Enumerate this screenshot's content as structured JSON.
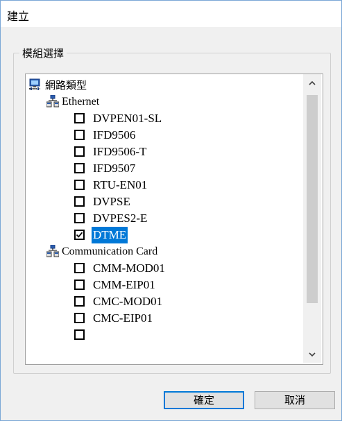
{
  "window": {
    "title": "建立"
  },
  "group": {
    "legend": "模組選擇"
  },
  "tree": {
    "root": {
      "label": "網路類型",
      "icon": "network-computer-icon"
    },
    "categories": [
      {
        "label": "Ethernet",
        "icon": "network-group-icon",
        "items": [
          {
            "label": "DVPEN01-SL",
            "checked": false,
            "selected": false
          },
          {
            "label": "IFD9506",
            "checked": false,
            "selected": false
          },
          {
            "label": "IFD9506-T",
            "checked": false,
            "selected": false
          },
          {
            "label": "IFD9507",
            "checked": false,
            "selected": false
          },
          {
            "label": "RTU-EN01",
            "checked": false,
            "selected": false
          },
          {
            "label": "DVPSE",
            "checked": false,
            "selected": false
          },
          {
            "label": "DVPES2-E",
            "checked": false,
            "selected": false
          },
          {
            "label": "DTME",
            "checked": true,
            "selected": true
          }
        ]
      },
      {
        "label": "Communication Card",
        "icon": "network-group-icon",
        "items": [
          {
            "label": "CMM-MOD01",
            "checked": false,
            "selected": false
          },
          {
            "label": "CMM-EIP01",
            "checked": false,
            "selected": false
          },
          {
            "label": "CMC-MOD01",
            "checked": false,
            "selected": false
          },
          {
            "label": "CMC-EIP01",
            "checked": false,
            "selected": false
          }
        ]
      }
    ]
  },
  "scrollbar": {
    "up_icon": "chevron-up-icon",
    "down_icon": "chevron-down-icon"
  },
  "buttons": {
    "ok": "確定",
    "cancel": "取消"
  },
  "colors": {
    "selection": "#0078d7",
    "window_border": "#7aa7d6"
  }
}
